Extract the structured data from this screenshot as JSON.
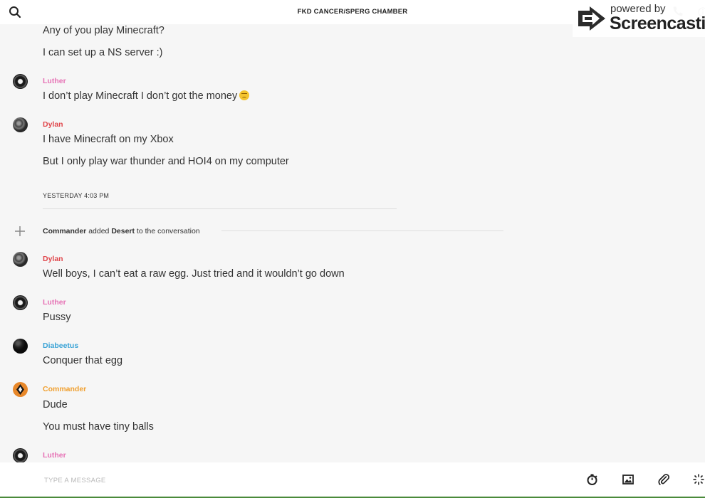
{
  "header": {
    "chat_title": "FKD CANCER/SPERG CHAMBER",
    "icons": [
      "search-icon",
      "phone-icon",
      "info-icon"
    ]
  },
  "watermark": {
    "line1": "powered by",
    "brand": "Screencastify"
  },
  "messages": [
    {
      "text": "Any of you play Minecraft?"
    },
    {
      "text": "I can set up a NS server :)"
    },
    {
      "sender": "Luther",
      "sender_color": "#e672b5",
      "text": "I don’t play Minecraft I don’t got the money",
      "emoji": "worried-face-emoji"
    },
    {
      "sender": "Dylan",
      "sender_color": "#e0474c",
      "text": "I have Minecraft on my Xbox"
    },
    {
      "text": "But I only play war thunder and HOI4 on my computer"
    },
    {
      "date_separator": "YESTERDAY 4:03 PM"
    },
    {
      "system": {
        "actor": "Commander",
        "verb": "added",
        "target": "Desert",
        "suffix": "to the conversation"
      }
    },
    {
      "sender": "Dylan",
      "sender_color": "#e0474c",
      "text": "Well boys, I can’t eat a raw egg. Just tried and it wouldn’t go down"
    },
    {
      "sender": "Luther",
      "sender_color": "#e672b5",
      "text": "Pussy"
    },
    {
      "sender": "Diabeetus",
      "sender_color": "#3aa3d6",
      "text": "Conquer that egg"
    },
    {
      "sender": "Commander",
      "sender_color": "#f0a030",
      "text": "Dude"
    },
    {
      "text": "You must have tiny balls"
    },
    {
      "sender": "Luther",
      "sender_color": "#e672b5"
    }
  ],
  "composer": {
    "placeholder": "TYPE A MESSAGE",
    "tools": [
      "timer-icon",
      "image-icon",
      "attachment-icon",
      "sparkle-icon"
    ]
  }
}
